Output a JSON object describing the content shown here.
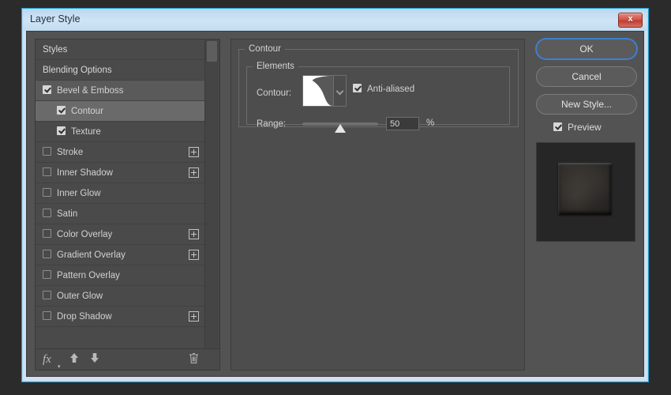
{
  "window": {
    "title": "Layer Style",
    "close_label": "x"
  },
  "styles_list": {
    "items": [
      {
        "label": "Styles",
        "checkbox": "none",
        "indent": false,
        "state": "normal",
        "plus": false
      },
      {
        "label": "Blending Options",
        "checkbox": "none",
        "indent": false,
        "state": "normal",
        "plus": false
      },
      {
        "label": "Bevel & Emboss",
        "checkbox": "checked",
        "indent": false,
        "state": "active-group",
        "plus": false
      },
      {
        "label": "Contour",
        "checkbox": "checked",
        "indent": true,
        "state": "selected",
        "plus": false
      },
      {
        "label": "Texture",
        "checkbox": "checked",
        "indent": true,
        "state": "normal",
        "plus": false
      },
      {
        "label": "Stroke",
        "checkbox": "unchecked",
        "indent": false,
        "state": "normal",
        "plus": true
      },
      {
        "label": "Inner Shadow",
        "checkbox": "unchecked",
        "indent": false,
        "state": "normal",
        "plus": true
      },
      {
        "label": "Inner Glow",
        "checkbox": "unchecked",
        "indent": false,
        "state": "normal",
        "plus": false
      },
      {
        "label": "Satin",
        "checkbox": "unchecked",
        "indent": false,
        "state": "normal",
        "plus": false
      },
      {
        "label": "Color Overlay",
        "checkbox": "unchecked",
        "indent": false,
        "state": "normal",
        "plus": true
      },
      {
        "label": "Gradient Overlay",
        "checkbox": "unchecked",
        "indent": false,
        "state": "normal",
        "plus": true
      },
      {
        "label": "Pattern Overlay",
        "checkbox": "unchecked",
        "indent": false,
        "state": "normal",
        "plus": false
      },
      {
        "label": "Outer Glow",
        "checkbox": "unchecked",
        "indent": false,
        "state": "normal",
        "plus": false
      },
      {
        "label": "Drop Shadow",
        "checkbox": "unchecked",
        "indent": false,
        "state": "normal",
        "plus": true
      }
    ],
    "toolbar": {
      "fx_label": "fx",
      "fx_caret": "▾",
      "move_up_icon": "arrow-up-icon",
      "move_down_icon": "arrow-down-icon",
      "delete_icon": "trash-icon"
    }
  },
  "content": {
    "group_title": "Contour",
    "subgroup_title": "Elements",
    "contour_label": "Contour:",
    "contour_preset": "cove-deep-curve",
    "anti_aliased_label": "Anti-aliased",
    "anti_aliased_checked": "checked",
    "range_label": "Range:",
    "range_value": "50",
    "range_unit": "%",
    "range_percent": 50
  },
  "buttons": {
    "ok": "OK",
    "cancel": "Cancel",
    "new_style": "New Style...",
    "preview_label": "Preview",
    "preview_checked": "checked"
  },
  "colors": {
    "dialog_bg": "#4d4d4d",
    "list_bg": "#4a4a4a",
    "selected_row": "#6a6a6a",
    "focus_ring": "#3f7fd0",
    "titlebar": "#cfe4f5",
    "close_red": "#bf3d31"
  }
}
